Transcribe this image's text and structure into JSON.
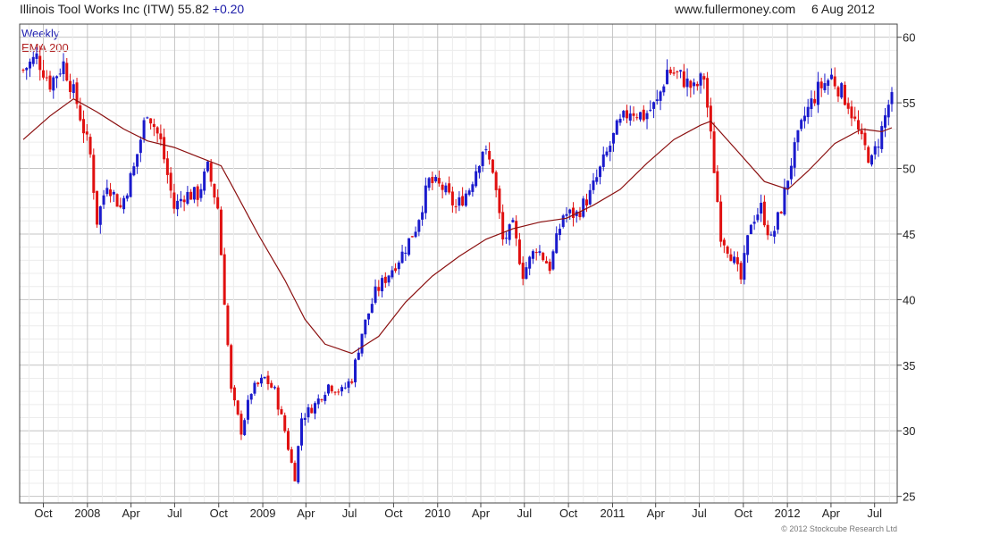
{
  "header": {
    "security": "Illinois Tool Works Inc (ITW)",
    "price": "55.82",
    "change": "+0.20",
    "site": "www.fullermoney.com",
    "date": "6 Aug 2012"
  },
  "legend": {
    "weekly": "Weekly",
    "ema": "EMA 200"
  },
  "footer": {
    "copyright": "© 2012 Stockcube Research Ltd"
  },
  "colors": {
    "up": "#1a1acc",
    "down": "#e01010",
    "ema": "#8b1010",
    "grid": "#d0d0d0"
  },
  "chart_data": {
    "type": "candlestick",
    "frequency": "weekly",
    "title": "Illinois Tool Works Inc (ITW)",
    "ylim": [
      24.5,
      61
    ],
    "y_ticks": [
      25,
      30,
      35,
      40,
      45,
      50,
      55,
      60
    ],
    "y_axis_side": "right",
    "grid": true,
    "legend_placement": "top-left",
    "x_ticks": [
      {
        "label": "Oct",
        "date": "2007-10-01"
      },
      {
        "label": "2008",
        "date": "2008-01-01"
      },
      {
        "label": "Apr",
        "date": "2008-04-01"
      },
      {
        "label": "Jul",
        "date": "2008-07-01"
      },
      {
        "label": "Oct",
        "date": "2008-10-01"
      },
      {
        "label": "2009",
        "date": "2009-01-01"
      },
      {
        "label": "Apr",
        "date": "2009-04-01"
      },
      {
        "label": "Jul",
        "date": "2009-07-01"
      },
      {
        "label": "Oct",
        "date": "2009-10-01"
      },
      {
        "label": "2010",
        "date": "2010-01-01"
      },
      {
        "label": "Apr",
        "date": "2010-04-01"
      },
      {
        "label": "Jul",
        "date": "2010-07-01"
      },
      {
        "label": "Oct",
        "date": "2010-10-01"
      },
      {
        "label": "2011",
        "date": "2011-01-01"
      },
      {
        "label": "Apr",
        "date": "2011-04-01"
      },
      {
        "label": "Jul",
        "date": "2011-07-01"
      },
      {
        "label": "Oct",
        "date": "2011-10-01"
      },
      {
        "label": "2012",
        "date": "2012-01-01"
      },
      {
        "label": "Apr",
        "date": "2012-04-01"
      },
      {
        "label": "Jul",
        "date": "2012-07-01"
      }
    ],
    "date_range": [
      "2007-08-20",
      "2012-08-06"
    ],
    "close_path": [
      [
        "2007-08-20",
        57.5
      ],
      [
        "2007-09-17",
        58.5
      ],
      [
        "2007-10-15",
        56.5
      ],
      [
        "2007-11-12",
        58.0
      ],
      [
        "2007-12-10",
        55.0
      ],
      [
        "2008-01-07",
        51.0
      ],
      [
        "2008-01-21",
        46.0
      ],
      [
        "2008-02-11",
        49.0
      ],
      [
        "2008-03-10",
        47.0
      ],
      [
        "2008-04-07",
        50.0
      ],
      [
        "2008-05-05",
        54.5
      ],
      [
        "2008-06-02",
        52.0
      ],
      [
        "2008-06-30",
        47.0
      ],
      [
        "2008-07-21",
        48.0
      ],
      [
        "2008-08-18",
        48.0
      ],
      [
        "2008-09-08",
        50.0
      ],
      [
        "2008-09-29",
        47.0
      ],
      [
        "2008-10-13",
        40.0
      ],
      [
        "2008-10-27",
        33.0
      ],
      [
        "2008-11-17",
        30.0
      ],
      [
        "2008-12-08",
        33.0
      ],
      [
        "2009-01-05",
        34.0
      ],
      [
        "2009-01-26",
        33.0
      ],
      [
        "2009-02-16",
        30.0
      ],
      [
        "2009-03-02",
        27.5
      ],
      [
        "2009-03-09",
        26.5
      ],
      [
        "2009-03-23",
        31.0
      ],
      [
        "2009-04-20",
        32.0
      ],
      [
        "2009-05-18",
        33.5
      ],
      [
        "2009-06-15",
        33.0
      ],
      [
        "2009-07-06",
        34.0
      ],
      [
        "2009-07-27",
        37.5
      ],
      [
        "2009-08-24",
        40.5
      ],
      [
        "2009-09-21",
        42.0
      ],
      [
        "2009-10-19",
        43.5
      ],
      [
        "2009-11-16",
        45.5
      ],
      [
        "2009-12-14",
        49.0
      ],
      [
        "2010-01-11",
        48.5
      ],
      [
        "2010-02-08",
        47.0
      ],
      [
        "2010-03-08",
        48.5
      ],
      [
        "2010-04-05",
        51.5
      ],
      [
        "2010-04-26",
        50.0
      ],
      [
        "2010-05-17",
        44.5
      ],
      [
        "2010-06-07",
        45.5
      ],
      [
        "2010-06-28",
        42.0
      ],
      [
        "2010-07-26",
        44.0
      ],
      [
        "2010-08-23",
        42.5
      ],
      [
        "2010-09-20",
        46.5
      ],
      [
        "2010-10-18",
        46.5
      ],
      [
        "2010-11-15",
        48.0
      ],
      [
        "2010-12-13",
        50.5
      ],
      [
        "2011-01-10",
        53.0
      ],
      [
        "2011-02-07",
        54.5
      ],
      [
        "2011-03-07",
        54.0
      ],
      [
        "2011-04-04",
        55.0
      ],
      [
        "2011-04-25",
        57.5
      ],
      [
        "2011-05-23",
        57.0
      ],
      [
        "2011-06-20",
        56.0
      ],
      [
        "2011-07-11",
        57.0
      ],
      [
        "2011-08-01",
        50.0
      ],
      [
        "2011-08-15",
        45.0
      ],
      [
        "2011-09-05",
        43.5
      ],
      [
        "2011-09-26",
        41.5
      ],
      [
        "2011-10-17",
        46.0
      ],
      [
        "2011-11-07",
        47.0
      ],
      [
        "2011-11-28",
        44.5
      ],
      [
        "2011-12-19",
        47.0
      ],
      [
        "2012-01-09",
        50.5
      ],
      [
        "2012-02-06",
        54.0
      ],
      [
        "2012-03-05",
        56.0
      ],
      [
        "2012-04-02",
        57.0
      ],
      [
        "2012-05-07",
        55.0
      ],
      [
        "2012-06-04",
        52.0
      ],
      [
        "2012-06-25",
        50.5
      ],
      [
        "2012-07-16",
        53.0
      ],
      [
        "2012-08-06",
        55.82
      ]
    ],
    "ema_200": [
      [
        "2007-08-20",
        52.2
      ],
      [
        "2007-10-15",
        54.0
      ],
      [
        "2007-12-03",
        55.3
      ],
      [
        "2008-01-21",
        54.3
      ],
      [
        "2008-03-17",
        53.0
      ],
      [
        "2008-05-05",
        52.1
      ],
      [
        "2008-06-30",
        51.6
      ],
      [
        "2008-08-25",
        50.8
      ],
      [
        "2008-10-06",
        50.2
      ],
      [
        "2008-10-27",
        48.8
      ],
      [
        "2008-12-22",
        45.0
      ],
      [
        "2009-02-16",
        41.5
      ],
      [
        "2009-03-30",
        38.5
      ],
      [
        "2009-05-11",
        36.6
      ],
      [
        "2009-07-06",
        35.9
      ],
      [
        "2009-08-31",
        37.2
      ],
      [
        "2009-10-26",
        39.8
      ],
      [
        "2009-12-21",
        41.8
      ],
      [
        "2010-02-15",
        43.3
      ],
      [
        "2010-04-12",
        44.6
      ],
      [
        "2010-06-07",
        45.4
      ],
      [
        "2010-08-02",
        45.9
      ],
      [
        "2010-09-27",
        46.2
      ],
      [
        "2010-11-22",
        47.2
      ],
      [
        "2011-01-17",
        48.4
      ],
      [
        "2011-03-14",
        50.4
      ],
      [
        "2011-05-09",
        52.2
      ],
      [
        "2011-07-04",
        53.3
      ],
      [
        "2011-07-25",
        53.6
      ],
      [
        "2011-09-19",
        51.3
      ],
      [
        "2011-11-14",
        49.0
      ],
      [
        "2012-01-02",
        48.4
      ],
      [
        "2012-02-13",
        49.8
      ],
      [
        "2012-04-09",
        51.9
      ],
      [
        "2012-06-04",
        53.0
      ],
      [
        "2012-07-16",
        52.8
      ],
      [
        "2012-08-06",
        53.1
      ]
    ]
  }
}
